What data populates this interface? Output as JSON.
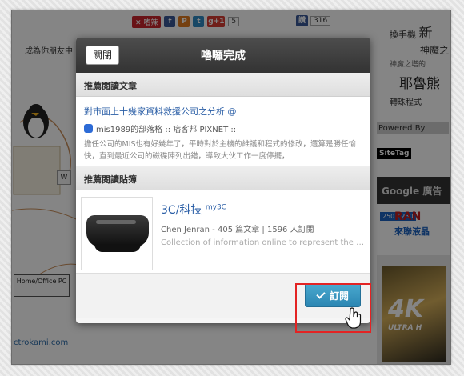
{
  "background": {
    "share": {
      "delicious": "✕ 嗜辣",
      "gplus": "g+1",
      "gplus_count": "5",
      "like": "讚",
      "like_count": "316"
    },
    "left_text": "成為你朋友中",
    "w_label": "W",
    "pc_box": "Home/Office PC",
    "url": "ctrokami.com",
    "right": {
      "l1a": "換手機",
      "l1b": "新",
      "l2": "神魔之",
      "l3": "神魔之塔的",
      "l4": "耶魯熊",
      "l5": "轉珠程式"
    },
    "powered": "Powered By",
    "sitetag": "SiteTag",
    "google_ads": "Google 廣告",
    "ad": {
      "badge": "250 X250",
      "brand": "RAN",
      "sub": "來聯液晶",
      "four_k": "4K",
      "ultra": "ULTRA H"
    }
  },
  "modal": {
    "close_label": "關閉",
    "title": "嚕囉完成",
    "articles_header": "推薦閱讀文章",
    "article": {
      "title": "對市面上十幾家資料救援公司之分析 @",
      "source": "mis1989的部落格 :: 痞客邦 PIXNET ::",
      "summary": "擔任公司的MIS也有好幾年了，平時對於主機的維護和程式的修改，還算是勝任愉快，直到最近公司的磁碟陣列出錯，導致大伙工作一度停擺，"
    },
    "magazine_header": "推薦閱讀貼簿",
    "magazine": {
      "title": "3C/科技",
      "title_sup": "my3C",
      "meta": "Chen Jenran - 405 篇文章 | 1596 人訂閱",
      "desc": "Collection of information online to represent the tr..."
    },
    "subscribe_label": "訂閱"
  }
}
